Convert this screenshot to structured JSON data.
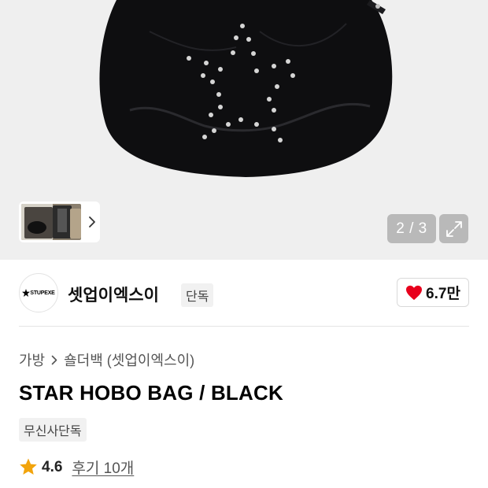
{
  "gallery": {
    "pager_text": "2 / 3",
    "bag_alt": "black hobo bag with star-shaped studs"
  },
  "brand": {
    "logo_text": "STUPEXE",
    "name": "셋업이엑스이",
    "tag": "단독",
    "likes": "6.7만",
    "heart_color": "#e8001c"
  },
  "breadcrumb": {
    "category": "가방",
    "subcategory": "숄더백 (셋업이엑스이)"
  },
  "product": {
    "title": "STAR HOBO BAG / BLACK",
    "exclusive_tag": "무신사단독"
  },
  "rating": {
    "value": "4.6",
    "reviews": "후기 10개",
    "star_color": "#f2a40c"
  }
}
